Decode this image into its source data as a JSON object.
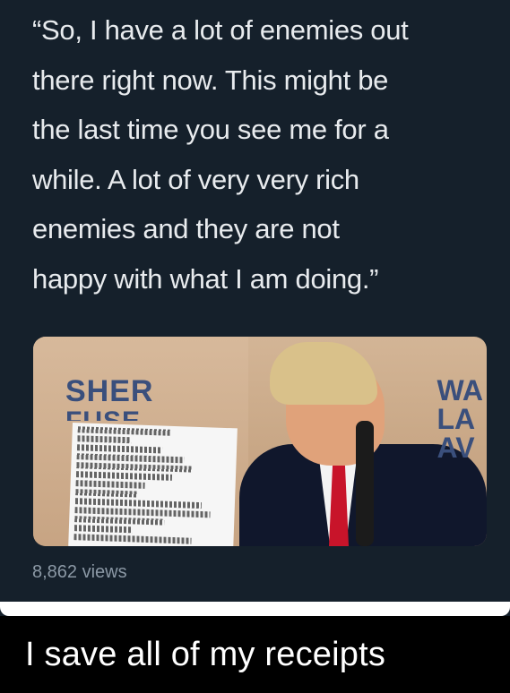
{
  "tweet": {
    "quote_lines": [
      "“So, I have a lot of enemies out",
      "there right now. This might be",
      "the last time you see me for a",
      "while. A lot of very very rich",
      "enemies and they are not",
      "happy with what I am doing.”"
    ],
    "views": "8,862 views"
  },
  "media": {
    "sign_left_line1": "SHER",
    "sign_left_line2": "FUSE",
    "sign_right_lines": [
      "WA",
      "LA",
      "AV"
    ]
  },
  "caption": {
    "text": "I save all of my receipts"
  },
  "colors": {
    "tweet_background": "#15202b",
    "text_primary": "#e8ebee",
    "text_secondary": "#8b98a5",
    "caption_background": "#000000",
    "caption_text": "#ffffff"
  }
}
